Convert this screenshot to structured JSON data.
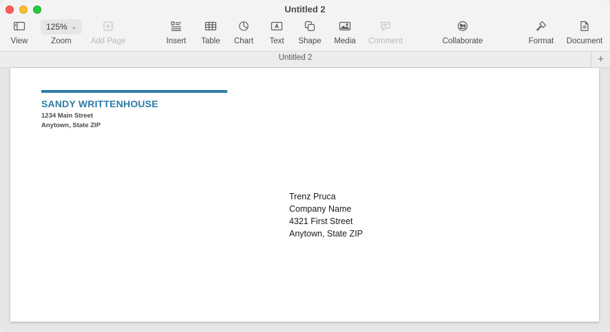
{
  "window": {
    "title": "Untitled 2"
  },
  "toolbar": {
    "view_label": "View",
    "zoom_value": "125%",
    "zoom_label": "Zoom",
    "add_page_label": "Add Page",
    "insert_label": "Insert",
    "table_label": "Table",
    "chart_label": "Chart",
    "text_label": "Text",
    "shape_label": "Shape",
    "media_label": "Media",
    "comment_label": "Comment",
    "collaborate_label": "Collaborate",
    "format_label": "Format",
    "document_label": "Document"
  },
  "tabbar": {
    "tab_title": "Untitled 2",
    "add_symbol": "+"
  },
  "document": {
    "accent_color": "#2e7aa6",
    "sender": {
      "name": "SANDY WRITTENHOUSE",
      "street": "1234 Main Street",
      "city": "Anytown, State ZIP"
    },
    "recipient": {
      "name": "Trenz Pruca",
      "company": "Company Name",
      "street": "4321 First Street",
      "city": "Anytown, State ZIP"
    }
  },
  "icons": {
    "view": "sidebar-icon",
    "add_page": "plus-square-icon",
    "insert": "list-insert-icon",
    "table": "table-icon",
    "chart": "pie-chart-icon",
    "text": "textbox-icon",
    "shape": "shape-icon",
    "media": "photo-icon",
    "comment": "speech-bubble-icon",
    "collaborate": "people-icon",
    "format": "paintbrush-icon",
    "document": "document-icon"
  }
}
